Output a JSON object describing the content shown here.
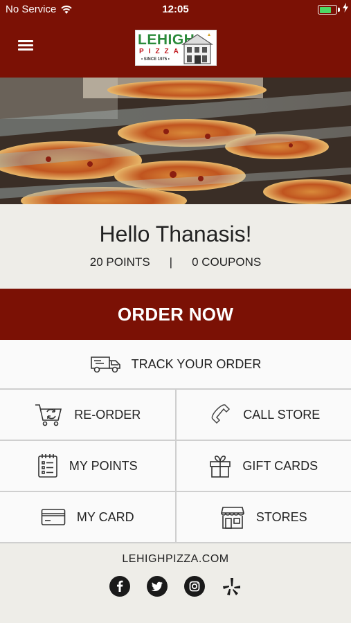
{
  "status_bar": {
    "carrier": "No Service",
    "time": "12:05",
    "battery_level": 0.75
  },
  "header": {
    "logo": {
      "name": "LEHIGH",
      "tagline": "PIZZA",
      "since": "• SINCE 1975 •"
    }
  },
  "greeting": {
    "text": "Hello Thanasis!",
    "points": "20 POINTS",
    "separator": "|",
    "coupons": "0 COUPONS"
  },
  "order_now": {
    "label": "ORDER NOW"
  },
  "track": {
    "label": "TRACK YOUR ORDER",
    "icon": "delivery-truck-icon"
  },
  "menu": {
    "reorder": {
      "label": "RE-ORDER",
      "icon": "cart-refresh-icon"
    },
    "call": {
      "label": "CALL STORE",
      "icon": "phone-icon"
    },
    "points": {
      "label": "MY POINTS",
      "icon": "notepad-icon"
    },
    "gift": {
      "label": "GIFT CARDS",
      "icon": "gift-icon"
    },
    "card": {
      "label": "MY CARD",
      "icon": "credit-card-icon"
    },
    "stores": {
      "label": "STORES",
      "icon": "storefront-icon"
    }
  },
  "footer": {
    "site": "LEHIGHPIZZA.COM",
    "socials": [
      "facebook-icon",
      "twitter-icon",
      "instagram-icon",
      "yelp-icon"
    ]
  },
  "colors": {
    "brand": "#7b1105",
    "background": "#eeede8",
    "tile": "#fafafa",
    "divider": "#cfcfcf"
  }
}
